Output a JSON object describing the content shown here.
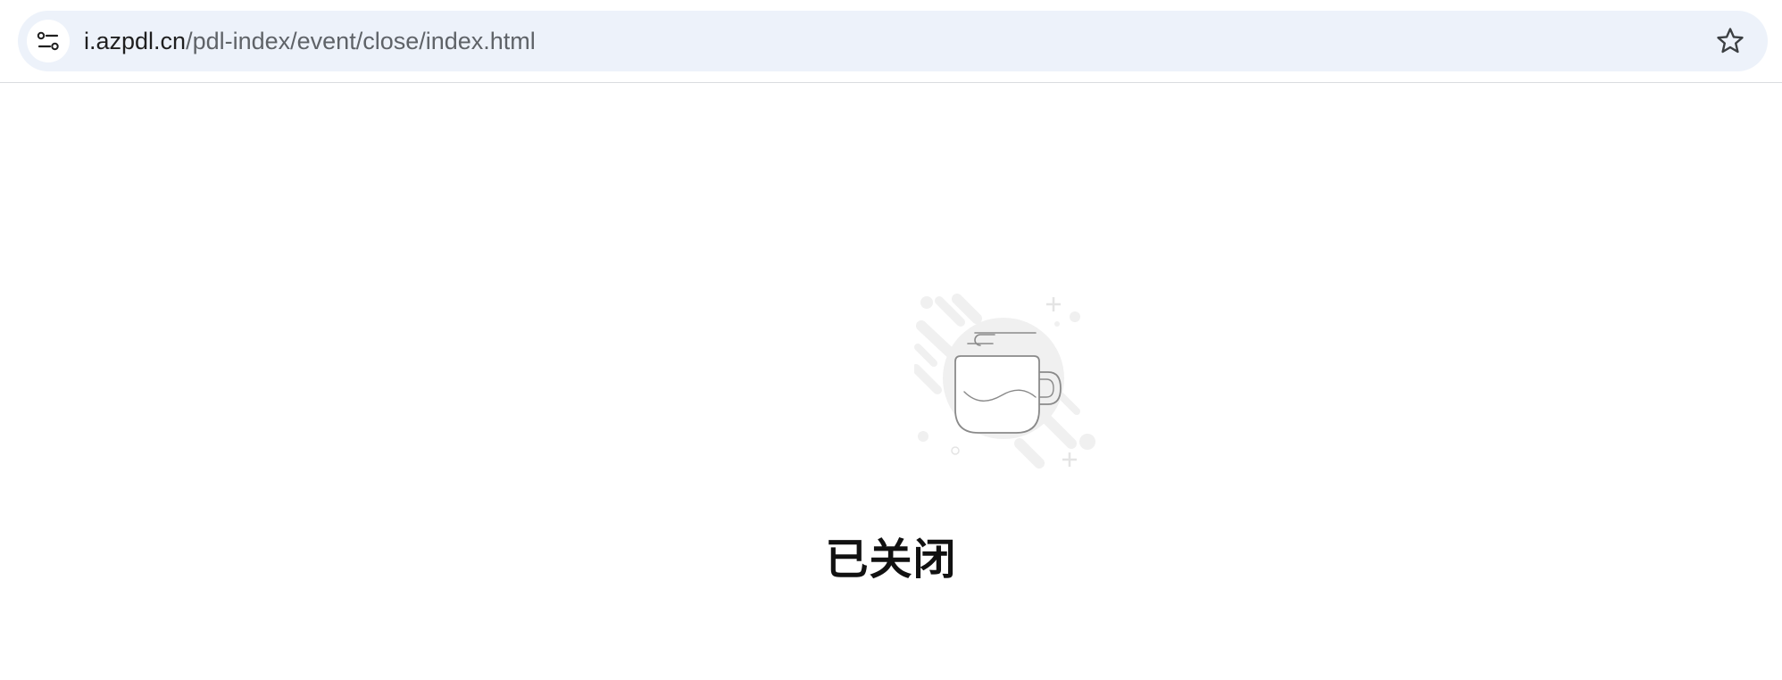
{
  "browser": {
    "url_host": "i.azpdl.cn",
    "url_path": "/pdl-index/event/close/index.html",
    "site_info_icon": "tune-icon",
    "bookmark_icon": "star-outline-icon"
  },
  "page": {
    "illustration_icon": "coffee-cup-icon",
    "status_text": "已关闭"
  },
  "colors": {
    "address_bar_bg": "#edf2fa",
    "illustration_gray": "#f0f0f0",
    "cup_stroke": "#8a8a8a",
    "title_text": "#111111"
  }
}
